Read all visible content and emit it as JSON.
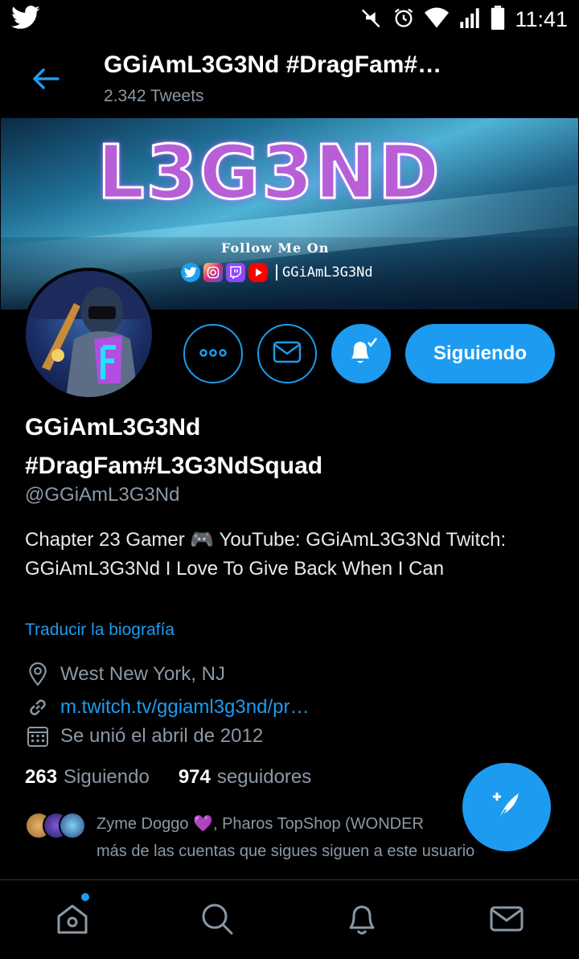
{
  "statusbar": {
    "time": "11:41",
    "icons": [
      "twitter-icon",
      "mute-icon",
      "alarm-icon",
      "wifi-icon",
      "signal-icon",
      "battery-icon"
    ]
  },
  "header": {
    "title": "GGiAmL3G3Nd #DragFam#…",
    "tweet_count": "2.342 Tweets"
  },
  "banner": {
    "logo_text": "L3G3ND",
    "follow_text": "Follow Me On",
    "handle": "GGiAmL3G3Nd"
  },
  "actions": {
    "follow_label": "Siguiendo"
  },
  "profile": {
    "name_line1": "GGiAmL3G3Nd",
    "name_line2": "#DragFam#L3G3NdSquad",
    "handle": "@GGiAmL3G3Nd",
    "bio": "Chapter 23 Gamer 🎮 YouTube: GGiAmL3G3Nd Twitch: GGiAmL3G3Nd I Love To Give Back When I Can",
    "translate_label": "Traducir la biografía",
    "location": "West New York, NJ",
    "link": "m.twitch.tv/ggiaml3g3nd/pr…",
    "joined": "Se unió el abril de 2012",
    "following_count": "263",
    "following_label": "Siguiendo",
    "followers_count": "974",
    "followers_label": "seguidores",
    "known_followers_line1": "Zyme Doggo 💜, Pharos TopShop (WONDER",
    "known_followers_line2": "más de las cuentas que sigues siguen a este usuario"
  },
  "colors": {
    "accent": "#1d9bf0",
    "background": "#000000",
    "secondary_text": "#8b98a5"
  },
  "nav": [
    "home-icon",
    "search-icon",
    "notifications-icon",
    "messages-icon"
  ]
}
